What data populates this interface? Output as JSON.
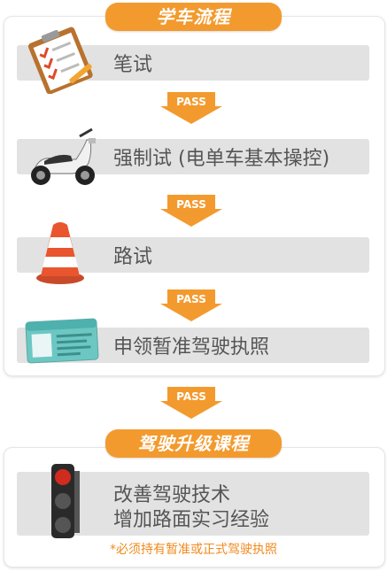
{
  "header_title": "学车流程",
  "steps": [
    {
      "label": "笔试",
      "icon": "clipboard-checklist-icon"
    },
    {
      "label": "强制试 (电单车基本操控)",
      "icon": "scooter-icon"
    },
    {
      "label": "路试",
      "icon": "traffic-cone-icon"
    },
    {
      "label": "申领暂准驾驶执照",
      "icon": "license-card-icon"
    }
  ],
  "pass_label": "PASS",
  "upgrade": {
    "title": "驾驶升级课程",
    "line1": "改善驾驶技术",
    "line2": "增加路面实习经验",
    "icon": "traffic-light-icon",
    "note": "*必须持有暂准或正式驾驶执照"
  },
  "colors": {
    "accent": "#f39a2e",
    "bar": "#e2e2e2",
    "text": "#555555",
    "note": "#f08a1c"
  }
}
